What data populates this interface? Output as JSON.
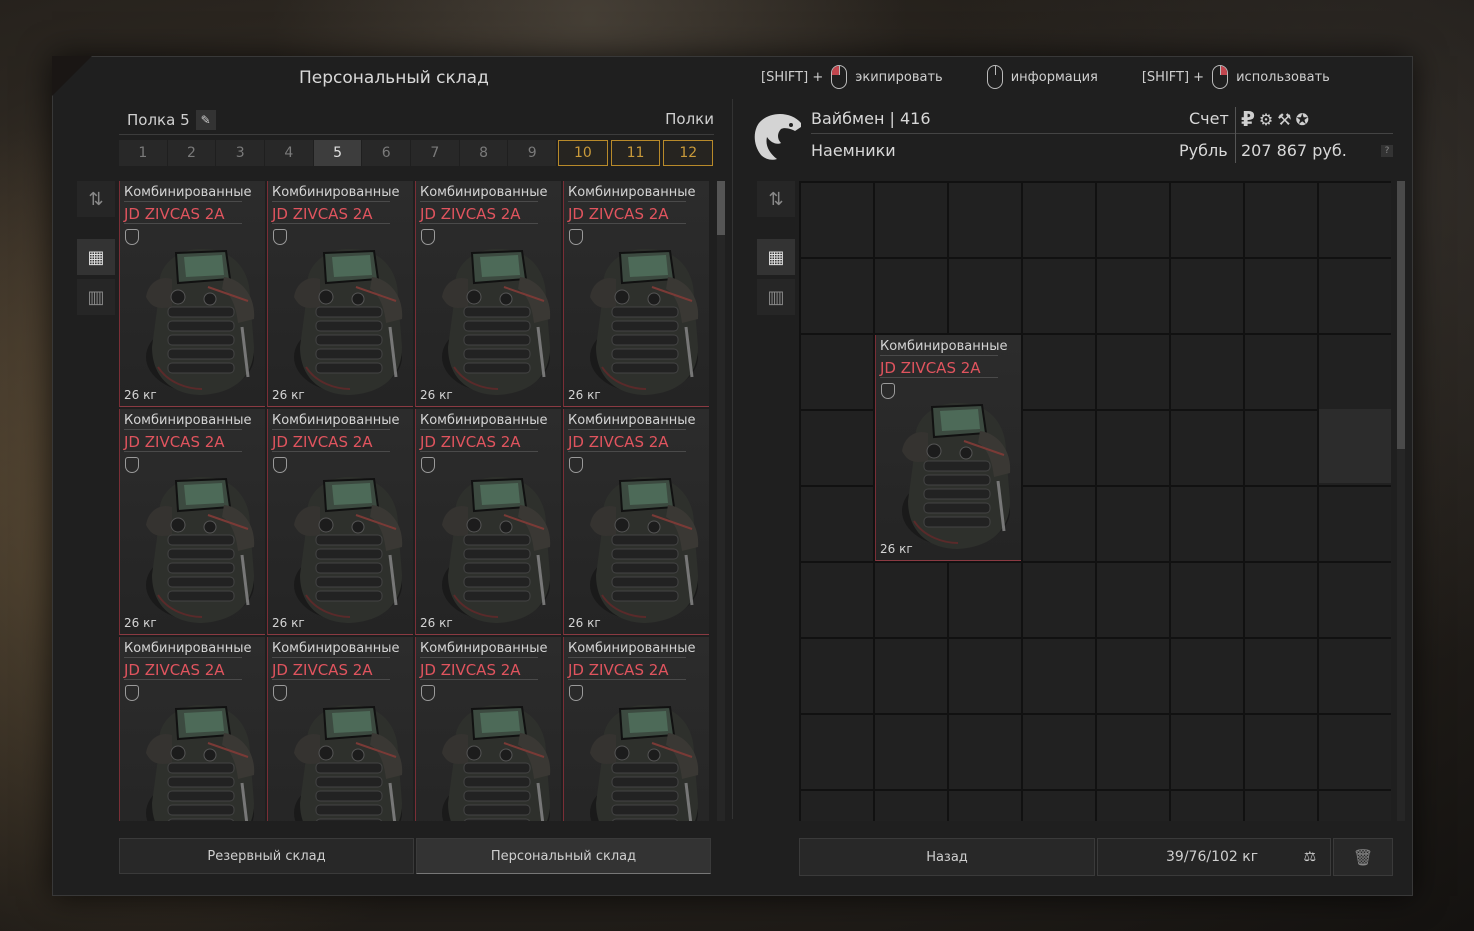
{
  "window": {
    "title": "Персональный склад"
  },
  "hints": [
    {
      "prefix": "[SHIFT] +",
      "label": "экипировать",
      "button": "left"
    },
    {
      "prefix": "",
      "label": "информация",
      "button": "none"
    },
    {
      "prefix": "[SHIFT] +",
      "label": "использовать",
      "button": "right"
    }
  ],
  "left": {
    "shelf_name": "Полка 5",
    "shelves_label": "Полки",
    "shelf_tabs": [
      "1",
      "2",
      "3",
      "4",
      "5",
      "6",
      "7",
      "8",
      "9",
      "10",
      "11",
      "12"
    ],
    "active_shelf": "5",
    "gold_shelves": [
      "10",
      "11",
      "12"
    ],
    "items": [
      {
        "category": "Комбинированные",
        "name": "JD ZIVCAS 2A",
        "weight": "26 кг"
      },
      {
        "category": "Комбинированные",
        "name": "JD ZIVCAS 2A",
        "weight": "26 кг"
      },
      {
        "category": "Комбинированные",
        "name": "JD ZIVCAS 2A",
        "weight": "26 кг"
      },
      {
        "category": "Комбинированные",
        "name": "JD ZIVCAS 2A",
        "weight": "26 кг"
      },
      {
        "category": "Комбинированные",
        "name": "JD ZIVCAS 2A",
        "weight": "26 кг"
      },
      {
        "category": "Комбинированные",
        "name": "JD ZIVCAS 2A",
        "weight": "26 кг"
      },
      {
        "category": "Комбинированные",
        "name": "JD ZIVCAS 2A",
        "weight": "26 кг"
      },
      {
        "category": "Комбинированные",
        "name": "JD ZIVCAS 2A",
        "weight": "26 кг"
      },
      {
        "category": "Комбинированные",
        "name": "JD ZIVCAS 2A",
        "weight": ""
      },
      {
        "category": "Комбинированные",
        "name": "JD ZIVCAS 2A",
        "weight": ""
      },
      {
        "category": "Комбинированные",
        "name": "JD ZIVCAS 2A",
        "weight": ""
      },
      {
        "category": "Комбинированные",
        "name": "JD ZIVCAS 2A",
        "weight": ""
      }
    ],
    "bottom_tabs": [
      "Резервный склад",
      "Персональный склад"
    ],
    "active_bottom_tab": "Персональный склад"
  },
  "right": {
    "trader_name": "Вайбмен | 416",
    "trader_group": "Наемники",
    "account_label": "Счет",
    "currency_label": "Рубль",
    "balance": "207 867 руб.",
    "currency_icons": [
      "ruble-icon",
      "gear-icon",
      "tools-icon",
      "compass-icon"
    ],
    "help": "?",
    "item": {
      "category": "Комбинированные",
      "name": "JD ZIVCAS 2A",
      "weight": "26 кг"
    },
    "back_label": "Назад",
    "weight_text": "39/76/102 кг"
  },
  "colors": {
    "accent_red": "#e0545e",
    "gold": "#c99a3a"
  }
}
